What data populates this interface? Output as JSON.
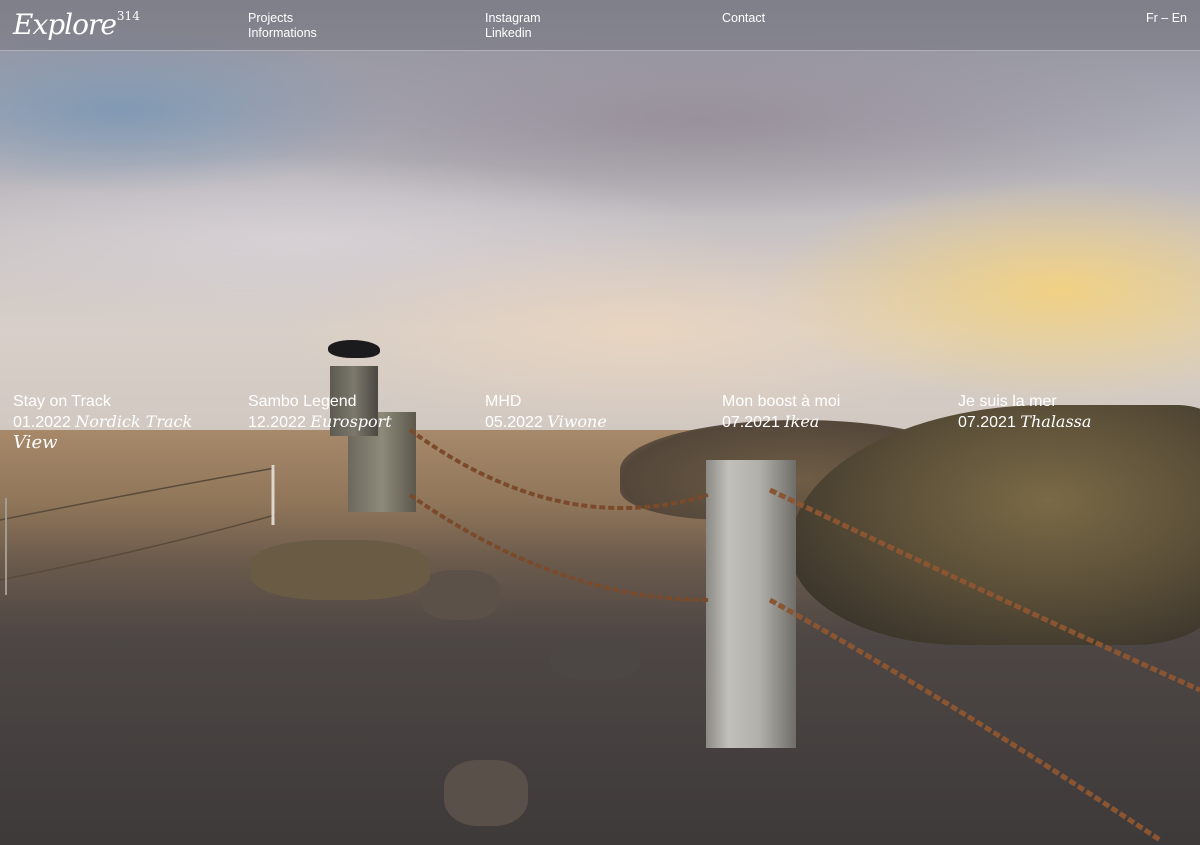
{
  "header": {
    "logo": {
      "text": "Explore",
      "sup": "314"
    },
    "nav_col_1": [
      "Projects",
      "Informations"
    ],
    "nav_col_2": [
      "Instagram",
      "Linkedin"
    ],
    "nav_col_3": [
      "Contact"
    ],
    "lang": {
      "fr": "Fr",
      "separator": " – ",
      "en": "En"
    }
  },
  "projects": [
    {
      "title": "Stay on Track",
      "date": "01.2022",
      "client": "Nordick Track"
    },
    {
      "title": "Sambo Legend",
      "date": "12.2022",
      "client": "Eurosport"
    },
    {
      "title": "MHD",
      "date": "05.2022",
      "client": "Viwone"
    },
    {
      "title": "Mon boost à moi",
      "date": "07.2021",
      "client": "Ikea"
    },
    {
      "title": "Je suis la mer",
      "date": "07.2021",
      "client": "Thalassa"
    }
  ],
  "view_link": "View"
}
